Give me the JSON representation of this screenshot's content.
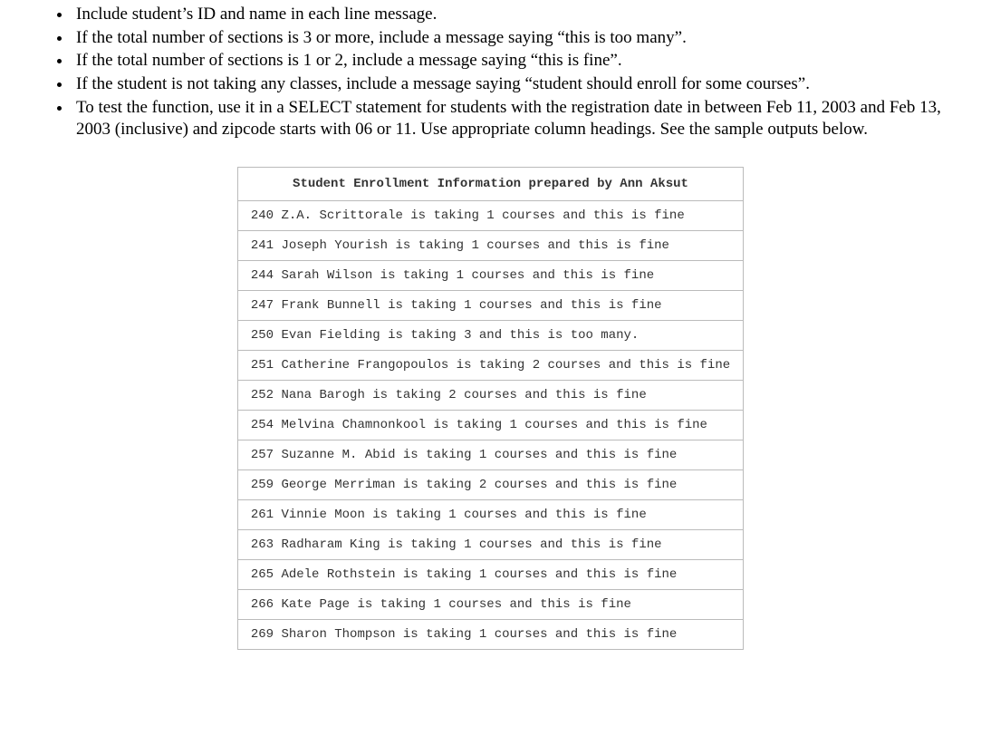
{
  "instructions": [
    "Include student’s ID and name in each line message.",
    "If the total number of sections is 3 or more, include a message saying “this is too many”.",
    "If the total number of sections is 1 or 2, include a message saying “this is fine”.",
    "If the student is not taking any classes, include a message saying “student should enroll for some courses”.",
    "To test the function, use it in a SELECT statement for students with the registration date in between Feb 11, 2003 and Feb 13, 2003 (inclusive) and zipcode starts with 06 or 11. Use appropriate column headings. See the sample outputs below."
  ],
  "table": {
    "header": "Student Enrollment Information prepared by Ann Aksut",
    "rows": [
      "240 Z.A. Scrittorale is taking 1 courses and this is fine",
      "241 Joseph Yourish is taking 1 courses and this is fine",
      "244 Sarah Wilson is taking 1 courses and this is fine",
      "247 Frank Bunnell is taking 1 courses and this is fine",
      "250 Evan Fielding is taking 3 and this is too many.",
      "251 Catherine Frangopoulos is taking 2 courses and this is fine",
      "252 Nana Barogh is taking 2 courses and this is fine",
      "254 Melvina Chamnonkool is taking 1 courses and this is fine",
      "257 Suzanne M. Abid is taking 1 courses and this is fine",
      "259 George Merriman is taking 2 courses and this is fine",
      "261 Vinnie Moon is taking 1 courses and this is fine",
      "263 Radharam King is taking 1 courses and this is fine",
      "265 Adele Rothstein is taking 1 courses and this is fine",
      "266 Kate Page is taking 1 courses and this is fine",
      "269 Sharon Thompson is taking 1 courses and this is fine"
    ]
  }
}
